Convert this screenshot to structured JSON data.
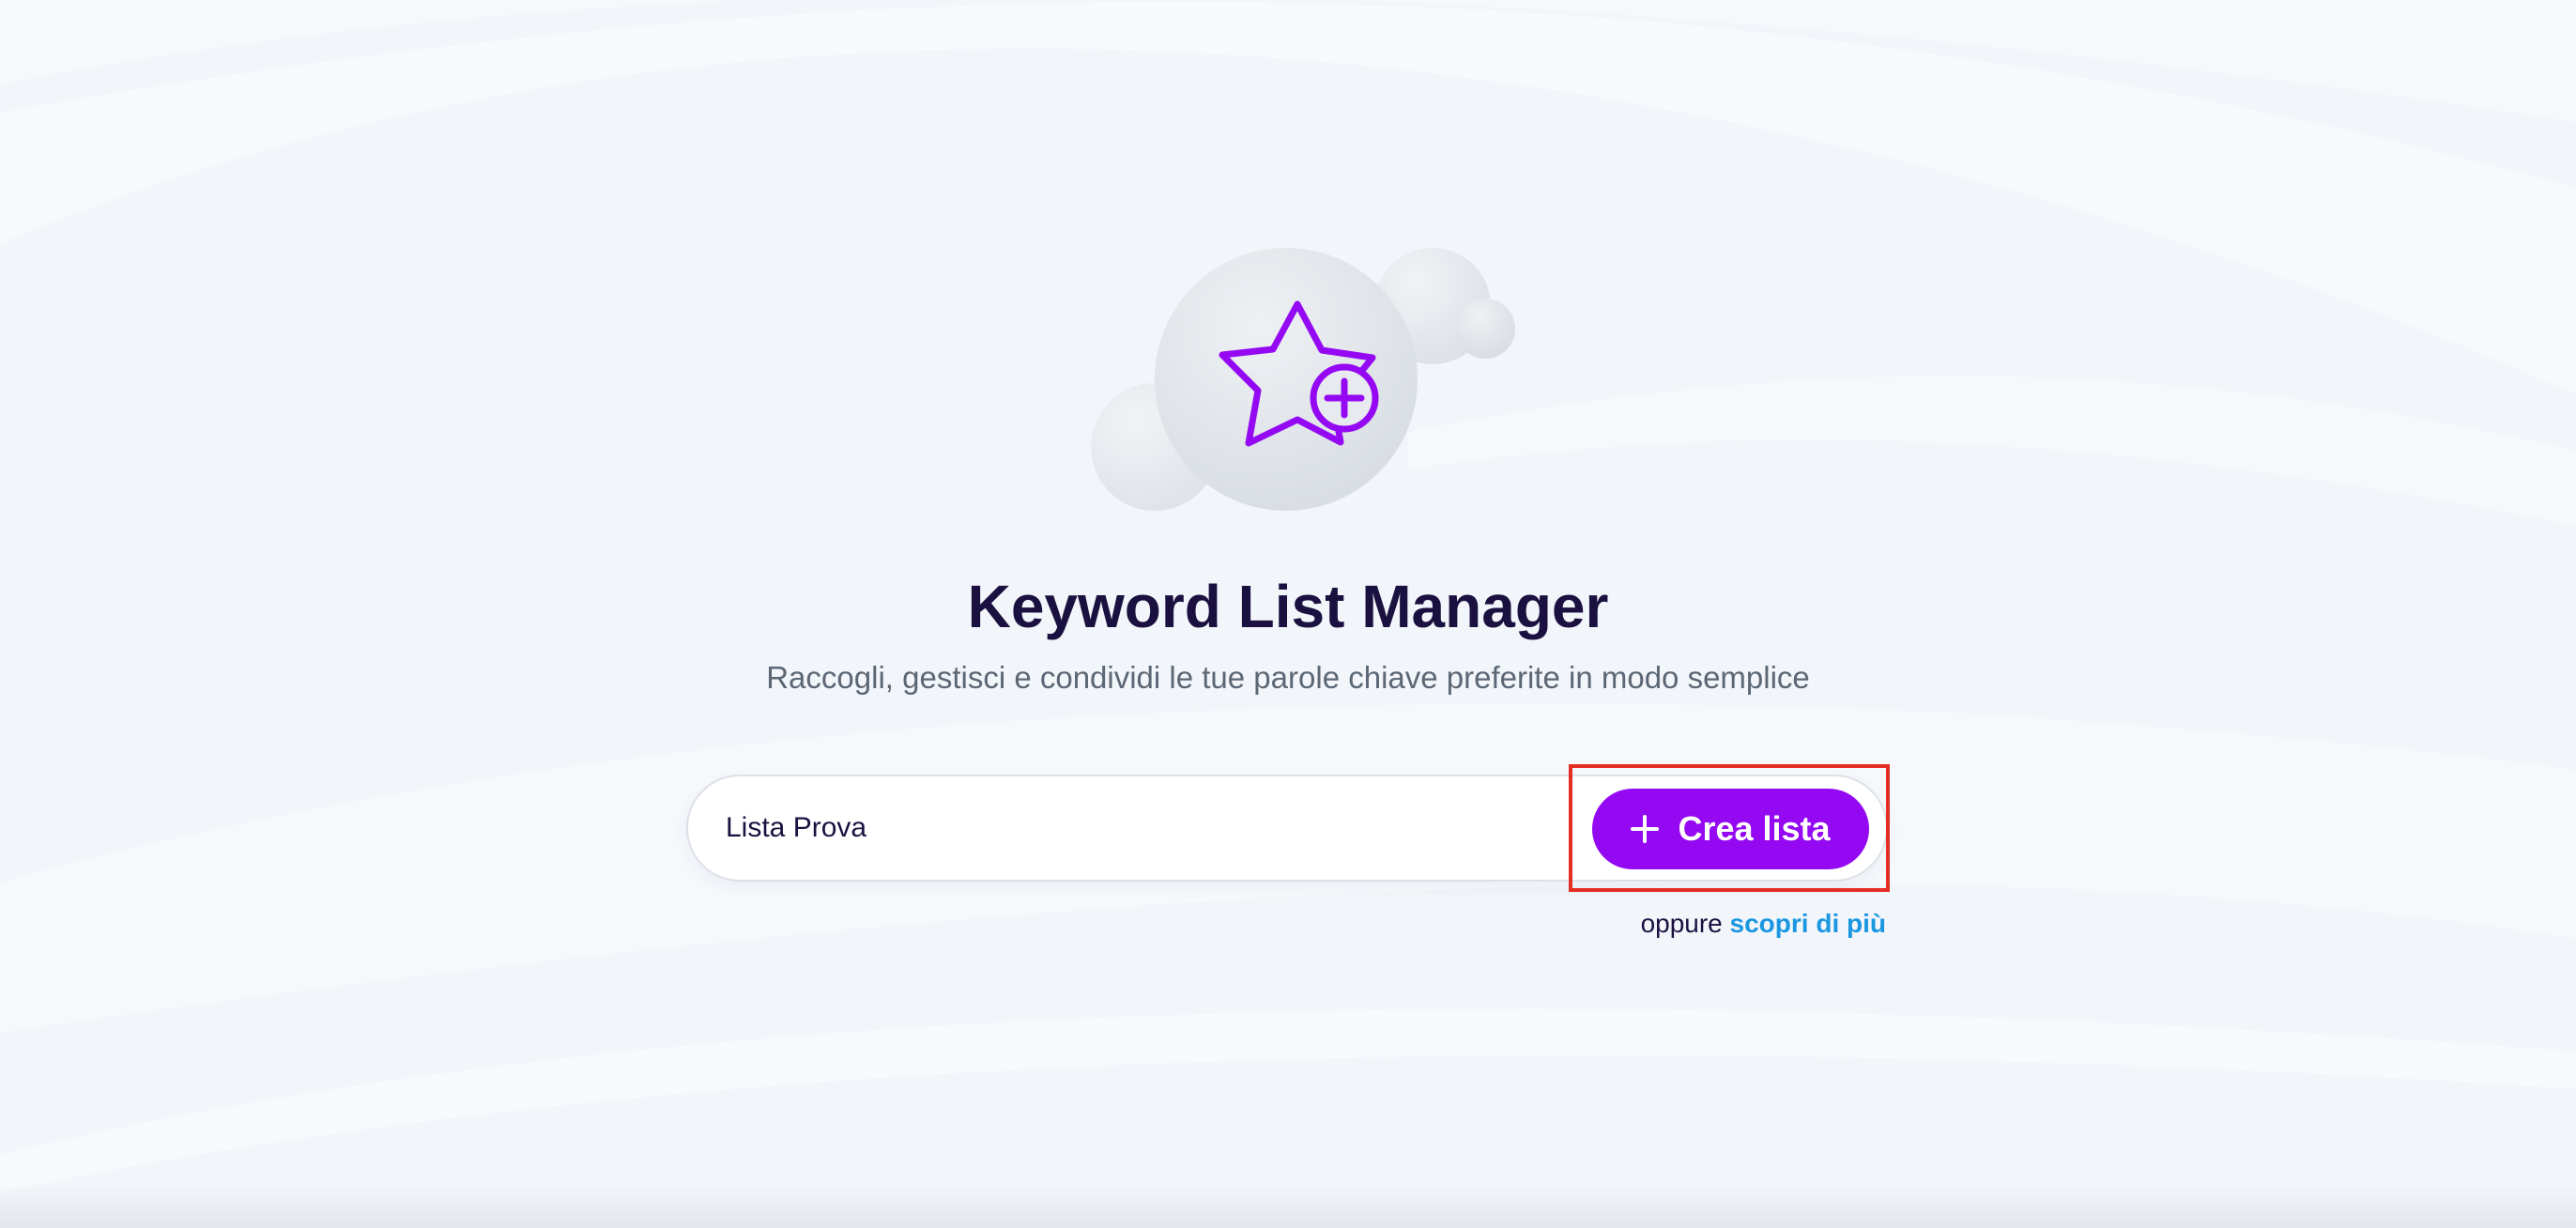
{
  "app": {
    "title": "Keyword List Manager",
    "subtitle": "Raccogli, gestisci e condividi le tue parole chiave preferite in modo semplice"
  },
  "hero": {
    "icon": "star-plus-icon"
  },
  "form": {
    "input_value": "Lista Prova",
    "create_button_label": "Crea lista",
    "create_button_icon": "plus-icon"
  },
  "alternative": {
    "prefix": "oppure",
    "link_label": "scopri di più"
  },
  "colors": {
    "accent": "#9409f2",
    "title": "#1b1140",
    "subtitle": "#5c6775",
    "link": "#1b97e1",
    "highlight": "#e42d23",
    "background": "#f2f5f9"
  }
}
